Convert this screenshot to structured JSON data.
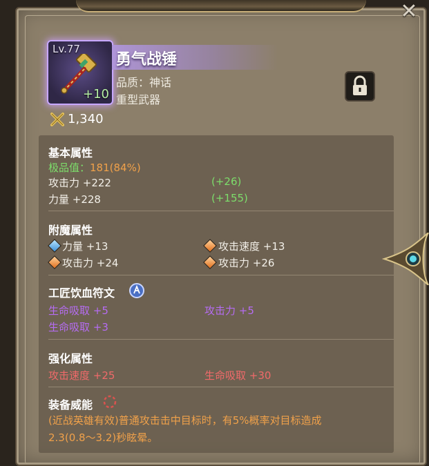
{
  "item": {
    "level": "Lv.77",
    "enhance": "+10",
    "name": "勇气战锤",
    "quality": "品质：神话",
    "type": "重型武器",
    "score": "1,340"
  },
  "basic": {
    "title": "基本属性",
    "quality_label": "极品值：",
    "quality_value": "181(84%)",
    "stats": [
      {
        "label": "攻击力 +222",
        "bonus": "(+26)"
      },
      {
        "label": "力量 +228",
        "bonus": "(+155)"
      }
    ]
  },
  "enchant": {
    "title": "附魔属性",
    "stats": [
      {
        "label": "力量 +13",
        "gem": "blue"
      },
      {
        "label": "攻击速度 +13",
        "gem": "orange"
      },
      {
        "label": "攻击力 +24",
        "gem": "orange"
      },
      {
        "label": "攻击力 +26",
        "gem": "orange"
      }
    ]
  },
  "rune": {
    "title": "工匠饮血符文",
    "icon": "rune-icon",
    "stats": [
      "生命吸取 +5",
      "攻击力 +5",
      "生命吸取 +3"
    ]
  },
  "enhance": {
    "title": "强化属性",
    "stats": [
      "攻击速度 +25",
      "生命吸取 +30"
    ]
  },
  "power": {
    "title": "装备威能",
    "icon": "power-icon",
    "desc_line1": "(近战英雄有效)普通攻击击中目标时，有5%概率对目标造成",
    "desc_line2": "2.3(0.8～3.2)秒眩晕。"
  },
  "buttons": {
    "close": "✕"
  },
  "colors": {
    "green": "#7dde6b",
    "orange": "#f0a14a",
    "purple": "#b56cf2",
    "red": "#f06a6a"
  }
}
